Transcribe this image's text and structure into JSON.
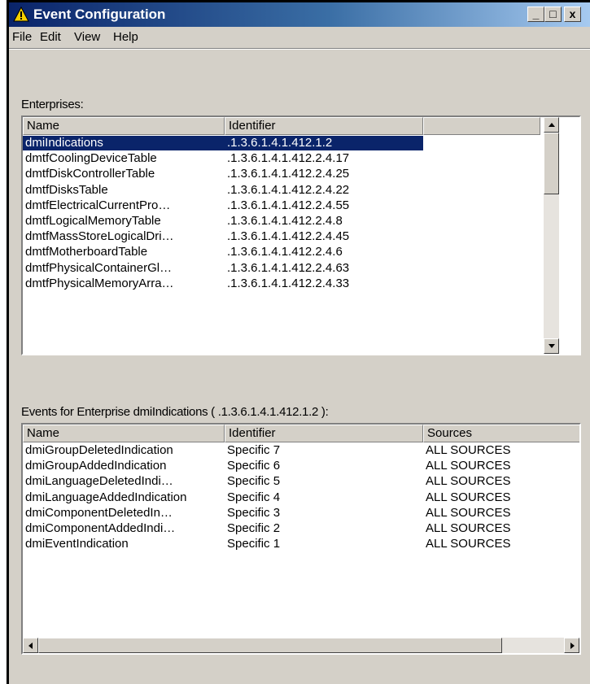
{
  "window": {
    "title": "Event Configuration",
    "controls": {
      "minimize": "_",
      "maximize": "□",
      "close": "x"
    }
  },
  "menu": [
    "File",
    "Edit",
    "View",
    "Help"
  ],
  "enterprises": {
    "label": "Enterprises:",
    "columns": [
      "Name",
      "Identifier",
      ""
    ],
    "rows": [
      {
        "name": "dmiIndications",
        "id": ".1.3.6.1.4.1.412.1.2",
        "selected": true
      },
      {
        "name": "dmtfCoolingDeviceTable",
        "id": ".1.3.6.1.4.1.412.2.4.17"
      },
      {
        "name": "dmtfDiskControllerTable",
        "id": ".1.3.6.1.4.1.412.2.4.25"
      },
      {
        "name": "dmtfDisksTable",
        "id": ".1.3.6.1.4.1.412.2.4.22"
      },
      {
        "name": "dmtfElectricalCurrentPro…",
        "id": ".1.3.6.1.4.1.412.2.4.55"
      },
      {
        "name": "dmtfLogicalMemoryTable",
        "id": ".1.3.6.1.4.1.412.2.4.8"
      },
      {
        "name": "dmtfMassStoreLogicalDri…",
        "id": ".1.3.6.1.4.1.412.2.4.45"
      },
      {
        "name": "dmtfMotherboardTable",
        "id": ".1.3.6.1.4.1.412.2.4.6"
      },
      {
        "name": "dmtfPhysicalContainerGl…",
        "id": ".1.3.6.1.4.1.412.2.4.63"
      },
      {
        "name": "dmtfPhysicalMemoryArra…",
        "id": ".1.3.6.1.4.1.412.2.4.33"
      }
    ]
  },
  "events": {
    "label": "Events for Enterprise dmiIndications ( .1.3.6.1.4.1.412.1.2 ):",
    "columns": [
      "Name",
      "Identifier",
      "Sources"
    ],
    "rows": [
      {
        "name": "dmiGroupDeletedIndication",
        "id": "Specific 7",
        "source": "ALL SOURCES"
      },
      {
        "name": "dmiGroupAddedIndication",
        "id": "Specific 6",
        "source": "ALL SOURCES"
      },
      {
        "name": "dmiLanguageDeletedIndi…",
        "id": "Specific 5",
        "source": "ALL SOURCES"
      },
      {
        "name": "dmiLanguageAddedIndication",
        "id": "Specific 4",
        "source": "ALL SOURCES"
      },
      {
        "name": "dmiComponentDeletedIn…",
        "id": "Specific 3",
        "source": "ALL SOURCES"
      },
      {
        "name": "dmiComponentAddedIndi…",
        "id": "Specific 2",
        "source": "ALL SOURCES"
      },
      {
        "name": "dmiEventIndication",
        "id": "Specific 1",
        "source": "ALL SOURCES"
      }
    ]
  },
  "colors": {
    "titlebar": "#0a246a",
    "selection": "#0a246a",
    "chrome": "#d4d0c8"
  },
  "icons": {
    "app": "warning-triangle-icon"
  }
}
